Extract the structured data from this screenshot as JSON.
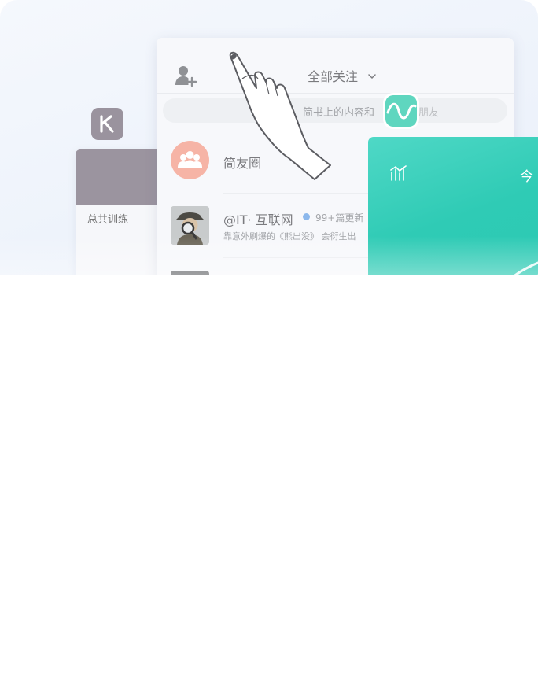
{
  "back_card": {
    "label": "总共训练"
  },
  "feed": {
    "title": "全部关注",
    "search_placeholder": "简书上的内容和",
    "search_suffix": "朋友",
    "rows": [
      {
        "title": "简友圈"
      },
      {
        "title": "@IT· 互联网",
        "badge": "99+篇更新",
        "snippet": "靠意外刷爆的《熊出没》 会衍生出"
      }
    ]
  },
  "teal_card": {
    "title": "今"
  },
  "colors": {
    "teal": "#2fcbb5",
    "coral": "#f6b4a6",
    "grey_card": "#9b949f",
    "blue_dot": "#8cb8ec"
  },
  "icons": [
    "k-app-icon",
    "add-user-icon",
    "chevron-down-icon",
    "wave-app-icon",
    "friends-group-icon",
    "bar-chart-icon",
    "pointing-hand-icon"
  ]
}
